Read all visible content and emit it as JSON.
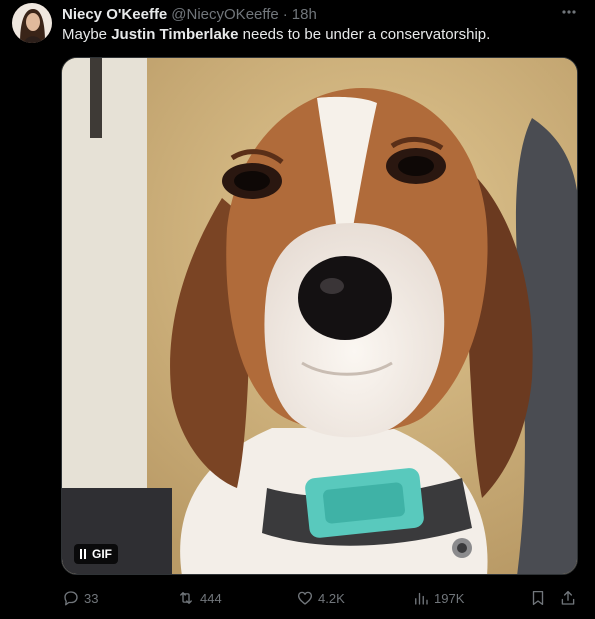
{
  "tweet": {
    "author": {
      "display_name": "Niecy O'Keeffe",
      "handle": "@NiecyOKeeffe",
      "separator": "·",
      "time": "18h"
    },
    "text": {
      "before": "Maybe ",
      "bold": "Justin Timberlake",
      "after": " needs to be under a conservatorship."
    },
    "media": {
      "badge_label": "GIF"
    },
    "actions": {
      "replies": "33",
      "reposts": "444",
      "likes": "4.2K",
      "views": "197K"
    }
  },
  "colors": {
    "background": "#000000",
    "primary_text": "#e7e9ea",
    "secondary_text": "#71767b",
    "border": "#2f3336"
  },
  "icons": {
    "more": "more-horizontal-icon",
    "reply": "reply-icon",
    "repost": "repost-icon",
    "like": "heart-icon",
    "views": "views-icon",
    "bookmark": "bookmark-icon",
    "share": "share-icon",
    "pause": "pause-icon"
  }
}
